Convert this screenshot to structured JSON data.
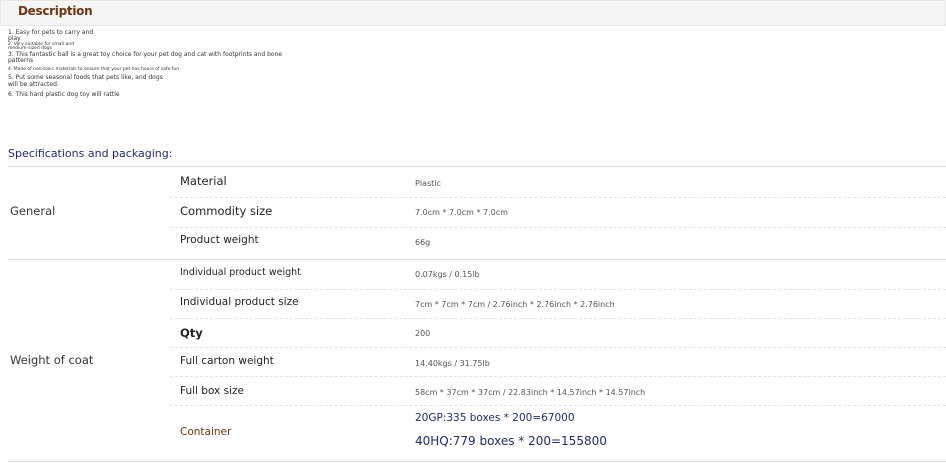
{
  "description": {
    "title": "Description",
    "lines": [
      "1. Easy for pets to carry and",
      "play",
      "2. Very suitable for small and",
      "medium-sized dogs",
      "3. This fantastic ball is a great toy choice for your pet dog and cat with footprints and bone",
      "patterns",
      "4. Made of non-toxic materials to ensure that your pet has hours of safe fun",
      "5. Put some seasonal foods that pets like, and dogs",
      "will be attracted.",
      "6. This hard plastic dog toy will rattle"
    ]
  },
  "specifications": {
    "title": "Specifications and packaging:",
    "groups": [
      {
        "label": "General",
        "rows": [
          {
            "label": "Material",
            "value": "Plastic"
          },
          {
            "label": "Commodity size",
            "value": "7.0cm * 7.0cm * 7.0cm"
          },
          {
            "label": "Product weight",
            "value": "66g"
          }
        ]
      },
      {
        "label": "Weight of coat",
        "rows": [
          {
            "label": "Individual product weight",
            "value": "0.07kgs / 0.15lb"
          },
          {
            "label": "Individual product size",
            "value": "7cm * 7cm * 7cm / 2.76inch * 2.76inch * 2.76inch"
          },
          {
            "label": "Qty",
            "value": "200"
          },
          {
            "label": "Full carton weight",
            "value": "14.40kgs / 31.75lb"
          },
          {
            "label": "Full box size",
            "value": "58cm * 37cm * 37cm / 22.83inch * 14.57inch * 14.57inch"
          },
          {
            "label": "Container",
            "values": [
              "20GP:335 boxes * 200=67000",
              "40HQ:779 boxes * 200=155800"
            ]
          }
        ]
      }
    ]
  }
}
